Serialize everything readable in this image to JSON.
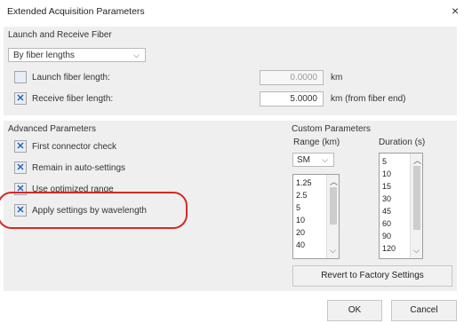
{
  "dialog": {
    "title": "Extended Acquisition Parameters",
    "close_symbol": "×"
  },
  "launch_receive": {
    "title": "Launch and Receive Fiber",
    "mode_select": {
      "value": "By fiber lengths"
    },
    "launch": {
      "label": "Launch fiber length:",
      "checked": false,
      "value": "0.0000",
      "unit": "km"
    },
    "receive": {
      "label": "Receive fiber length:",
      "checked": true,
      "value": "5.0000",
      "unit": "km (from fiber end)"
    }
  },
  "advanced": {
    "title": "Advanced Parameters",
    "items": [
      {
        "label": "First connector check",
        "checked": true
      },
      {
        "label": "Remain in auto-settings",
        "checked": true
      },
      {
        "label": "Use optimized range",
        "checked": true
      },
      {
        "label": "Apply settings by wavelength",
        "checked": true
      }
    ]
  },
  "custom": {
    "title": "Custom Parameters",
    "range_header": "Range (km)",
    "duration_header": "Duration (s)",
    "fiber_select": "SM",
    "range_values": [
      "1.25",
      "2.5",
      "5",
      "10",
      "20",
      "40"
    ],
    "duration_values": [
      "5",
      "10",
      "15",
      "30",
      "45",
      "60",
      "90",
      "120"
    ],
    "revert_label": "Revert to Factory Settings"
  },
  "footer": {
    "ok_label": "OK",
    "cancel_label": "Cancel"
  },
  "colors": {
    "checkmark": "#2a63b7",
    "highlight": "#d42a25",
    "section_bg": "#efefef"
  },
  "icons": {
    "check": "x-check-icon",
    "chevron": "chevron-down-icon"
  }
}
